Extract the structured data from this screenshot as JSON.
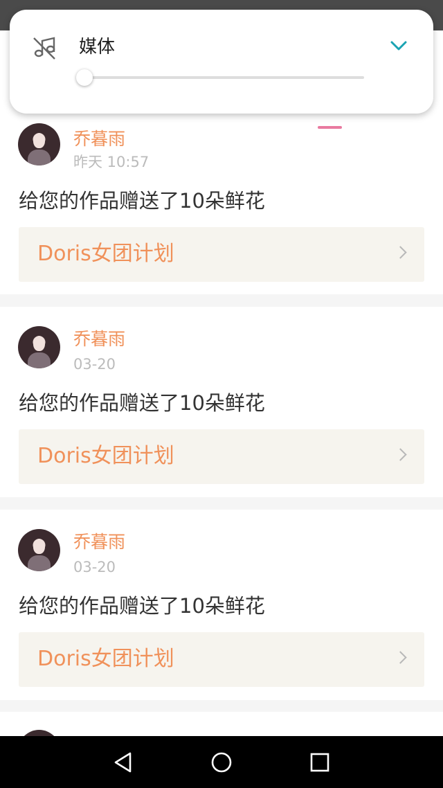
{
  "volume_panel": {
    "label": "媒体",
    "level": 0,
    "icons": {
      "muted": "music-off-icon",
      "expand": "chevron-down-icon"
    },
    "accent_color": "#1aa3b2"
  },
  "tabs": {
    "active_indicator_color": "#e97aa0"
  },
  "feed": {
    "items": [
      {
        "name": "乔暮雨",
        "time": "昨天 10:57",
        "message": "给您的作品赠送了10朵鲜花",
        "work_title": "Doris女团计划"
      },
      {
        "name": "乔暮雨",
        "time": "03-20",
        "message": "给您的作品赠送了10朵鲜花",
        "work_title": "Doris女团计划"
      },
      {
        "name": "乔暮雨",
        "time": "03-20",
        "message": "给您的作品赠送了10朵鲜花",
        "work_title": "Doris女团计划"
      }
    ],
    "name_color": "#f0915a"
  },
  "nav_bar": {
    "icons": [
      "back-icon",
      "home-icon",
      "recents-icon"
    ]
  }
}
